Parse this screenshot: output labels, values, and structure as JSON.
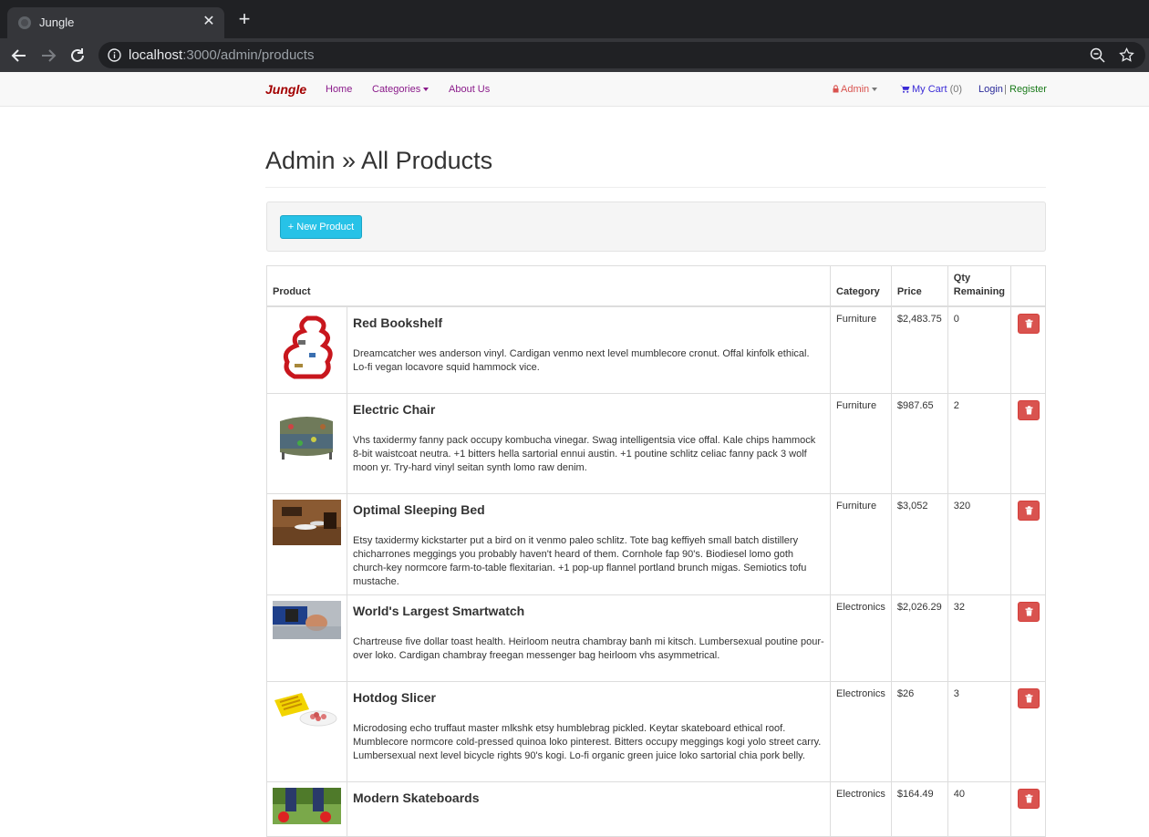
{
  "browser": {
    "tab_title": "Jungle",
    "url_host": "localhost",
    "url_rest": ":3000/admin/products"
  },
  "navbar": {
    "brand": "Jungle",
    "links": {
      "home": "Home",
      "categories": "Categories",
      "about": "About Us",
      "admin": "Admin",
      "cart": "My Cart",
      "cart_count": "(0)",
      "login": "Login",
      "separator": "|",
      "register": "Register"
    },
    "colors": {
      "brand": "#a30000",
      "admin": "#d9534f",
      "cart": "#3a2ad6",
      "register": "#1a7a1a"
    }
  },
  "page": {
    "title": "Admin » All Products",
    "new_product_label": "+ New Product"
  },
  "table": {
    "headers": {
      "product": "Product",
      "category": "Category",
      "price": "Price",
      "qty": "Qty Remaining"
    },
    "rows": [
      {
        "name": "Red Bookshelf",
        "description": "Dreamcatcher wes anderson vinyl. Cardigan venmo next level mumblecore cronut. Offal kinfolk ethical. Lo-fi vegan locavore squid hammock vice.",
        "category": "Furniture",
        "price": "$2,483.75",
        "qty": "0"
      },
      {
        "name": "Electric Chair",
        "description": "Vhs taxidermy fanny pack occupy kombucha vinegar. Swag intelligentsia vice offal. Kale chips hammock 8-bit waistcoat neutra. +1 bitters hella sartorial ennui austin. +1 poutine schlitz celiac fanny pack 3 wolf moon yr. Try-hard vinyl seitan synth lomo raw denim.",
        "category": "Furniture",
        "price": "$987.65",
        "qty": "2"
      },
      {
        "name": "Optimal Sleeping Bed",
        "description": "Etsy taxidermy kickstarter put a bird on it venmo paleo schlitz. Tote bag keffiyeh small batch distillery chicharrones meggings you probably haven't heard of them. Cornhole fap 90's. Biodiesel lomo goth church-key normcore farm-to-table flexitarian. +1 pop-up flannel portland brunch migas. Semiotics tofu mustache.",
        "category": "Furniture",
        "price": "$3,052",
        "qty": "320"
      },
      {
        "name": "World's Largest Smartwatch",
        "description": "Chartreuse five dollar toast health. Heirloom neutra chambray banh mi kitsch. Lumbersexual poutine pour-over loko. Cardigan chambray freegan messenger bag heirloom vhs asymmetrical.",
        "category": "Electronics",
        "price": "$2,026.29",
        "qty": "32"
      },
      {
        "name": "Hotdog Slicer",
        "description": "Microdosing echo truffaut master mlkshk etsy humblebrag pickled. Keytar skateboard ethical roof. Mumblecore normcore cold-pressed quinoa loko pinterest. Bitters occupy meggings kogi yolo street carry. Lumbersexual next level bicycle rights 90's kogi. Lo-fi organic green juice loko sartorial chia pork belly.",
        "category": "Electronics",
        "price": "$26",
        "qty": "3"
      },
      {
        "name": "Modern Skateboards",
        "description": "",
        "category": "Electronics",
        "price": "$164.49",
        "qty": "40"
      }
    ]
  }
}
